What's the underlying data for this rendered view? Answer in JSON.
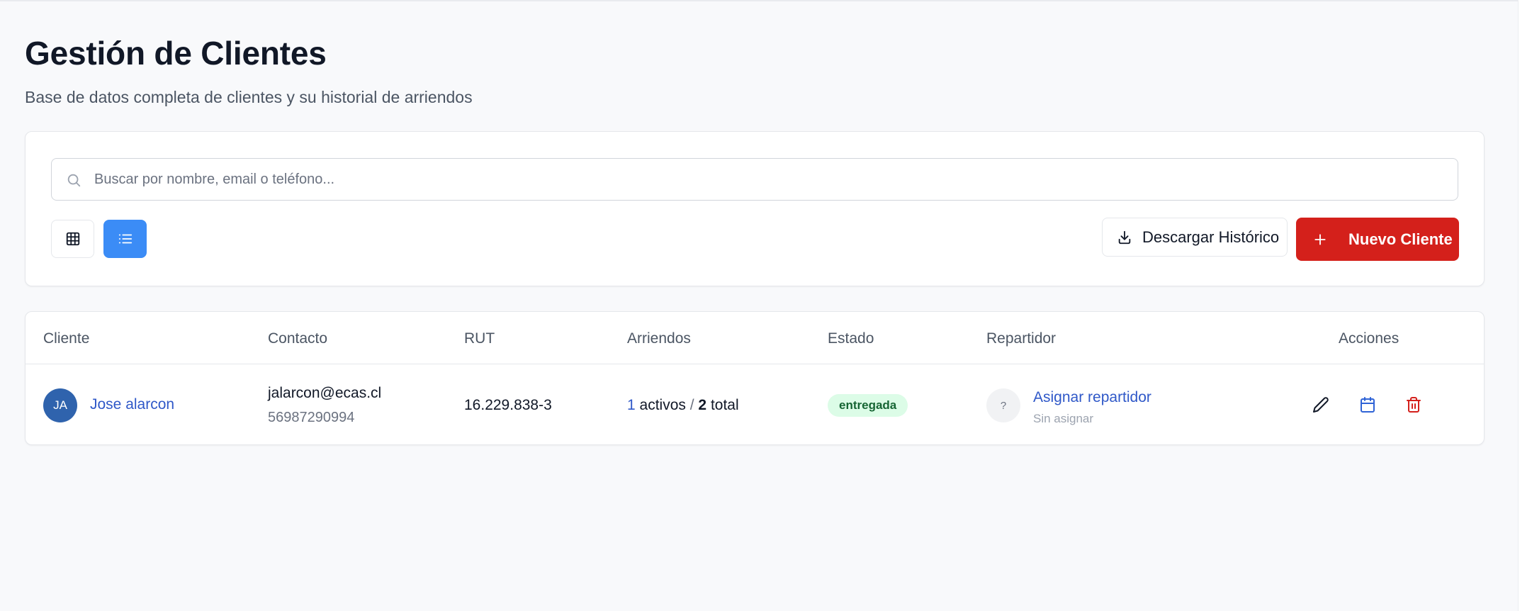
{
  "header": {
    "title": "Gestión de Clientes",
    "subtitle": "Base de datos completa de clientes y su historial de arriendos"
  },
  "toolbar": {
    "search_placeholder": "Buscar por nombre, email o teléfono...",
    "search_value": "",
    "view_grid_icon": "grid-icon",
    "view_list_icon": "list-icon",
    "active_view": "list",
    "download_label": "Descargar Histórico",
    "new_client_label": "Nuevo Cliente"
  },
  "table": {
    "columns": {
      "client": "Cliente",
      "contact": "Contacto",
      "rut": "RUT",
      "rentals": "Arriendos",
      "status": "Estado",
      "courier": "Repartidor",
      "actions": "Acciones"
    },
    "rows": [
      {
        "initials": "JA",
        "name": "Jose alarcon",
        "email": "jalarcon@ecas.cl",
        "phone": "56987290994",
        "rut": "16.229.838-3",
        "rentals_active": "1",
        "rentals_active_label": "activos",
        "rentals_separator": "/",
        "rentals_total": "2",
        "rentals_total_label": "total",
        "status": "entregada",
        "courier_initial": "?",
        "courier_action": "Asignar repartidor",
        "courier_status": "Sin asignar"
      }
    ]
  },
  "colors": {
    "primary_blue": "#3b8cf6",
    "link_blue": "#2f58c8",
    "danger_red": "#d4201b",
    "success_bg": "#dcfce7",
    "success_text": "#166534"
  }
}
